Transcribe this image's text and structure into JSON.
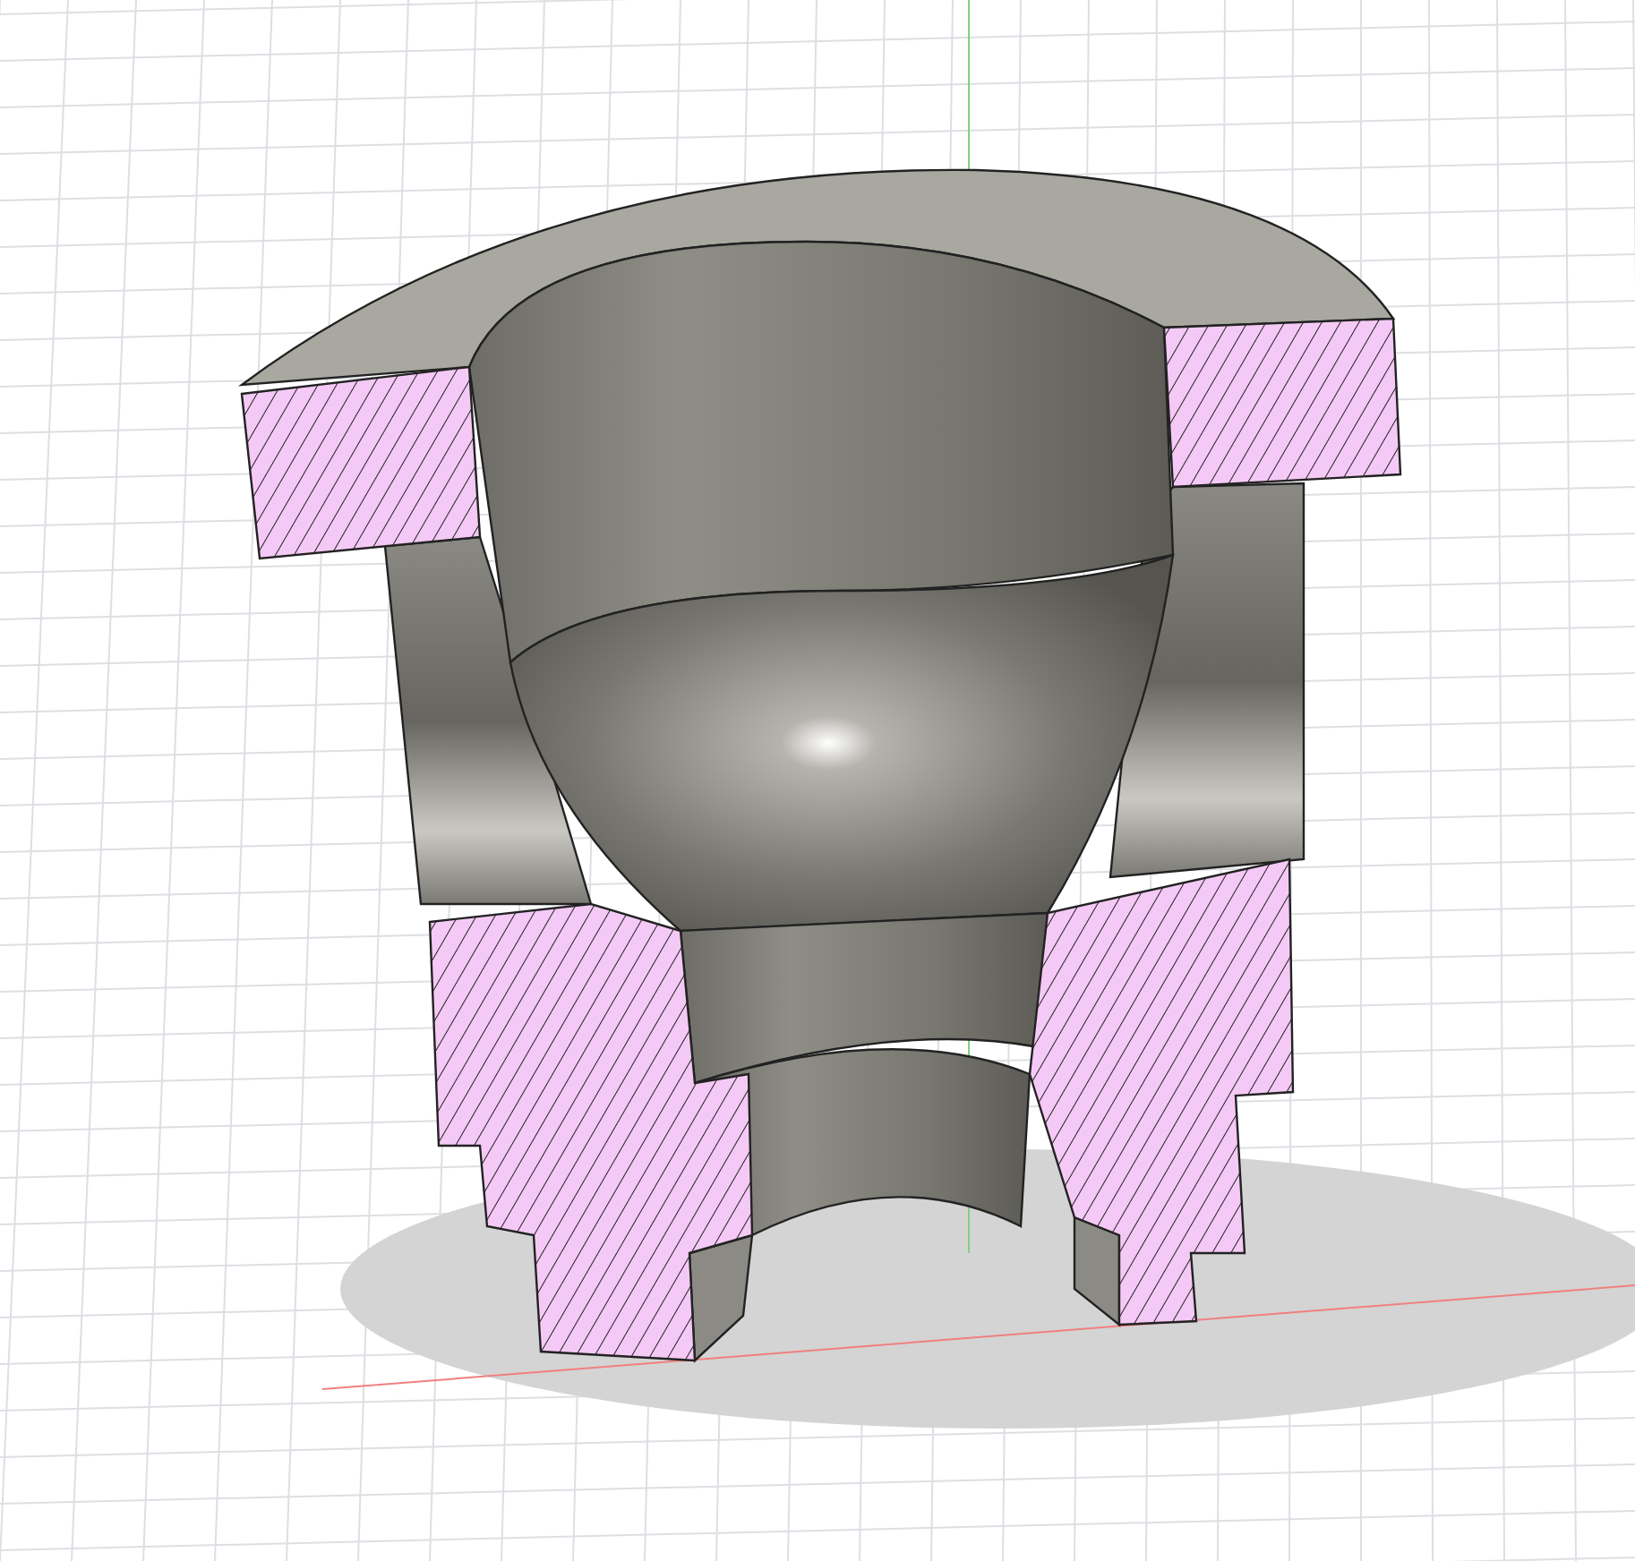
{
  "viewport": {
    "grid": true,
    "axes": true,
    "section_hatch": true
  }
}
